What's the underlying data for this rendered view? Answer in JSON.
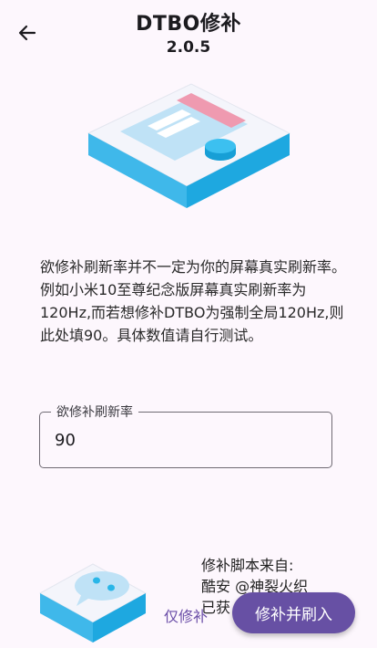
{
  "header": {
    "title": "DTBO修补",
    "version": "2.0.5"
  },
  "description": {
    "line1": "欲修补刷新率并不一定为你的屏幕真实刷新率。",
    "line2": "例如小米10至尊纪念版屏幕真实刷新率为120Hz,而若想修补DTBO为强制全局120Hz,则此处填90。具体数值请自行测试。"
  },
  "field": {
    "label": "欲修补刷新率",
    "value": "90"
  },
  "source": {
    "line1": "修补脚本来自:",
    "line2": "酷安 @神裂火织",
    "line3": "已获"
  },
  "actions": {
    "only_patch": "仅修补",
    "patch_and_flash": "修补并刷入"
  },
  "colors": {
    "accent": "#6750a4",
    "illustration_cyan": "#29b6e8"
  }
}
